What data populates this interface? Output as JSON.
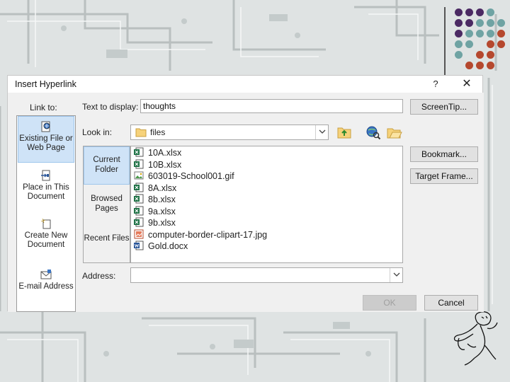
{
  "dialog": {
    "title": "Insert Hyperlink",
    "help_label": "?",
    "close_label": "✕"
  },
  "link_to": {
    "label": "Link to:",
    "items": [
      {
        "label": "Existing File or Web Page",
        "icon": "existing-file-icon",
        "selected": true
      },
      {
        "label": "Place in This Document",
        "icon": "place-in-document-icon",
        "selected": false
      },
      {
        "label": "Create New Document",
        "icon": "new-document-icon",
        "selected": false
      },
      {
        "label": "E-mail Address",
        "icon": "email-icon",
        "selected": false
      }
    ]
  },
  "text_to_display": {
    "label": "Text to display:",
    "value": "thoughts"
  },
  "screen_tip_button": "ScreenTip...",
  "look_in": {
    "label": "Look in:",
    "value": "files",
    "folder_icon": "folder-icon"
  },
  "toolbar_icons": [
    "up-folder-icon",
    "browse-web-icon",
    "browse-file-icon"
  ],
  "places": [
    {
      "label": "Current Folder",
      "selected": true
    },
    {
      "label": "Browsed Pages",
      "selected": false
    },
    {
      "label": "Recent Files",
      "selected": false
    }
  ],
  "files": [
    {
      "name": "10A.xlsx",
      "type": "excel"
    },
    {
      "name": "10B.xlsx",
      "type": "excel"
    },
    {
      "name": "603019-School001.gif",
      "type": "image"
    },
    {
      "name": "8A.xlsx",
      "type": "excel"
    },
    {
      "name": "8b.xlsx",
      "type": "excel"
    },
    {
      "name": "9a.xlsx",
      "type": "excel"
    },
    {
      "name": "9b.xlsx",
      "type": "excel"
    },
    {
      "name": "computer-border-clipart-17.jpg",
      "type": "jpg"
    },
    {
      "name": "Gold.docx",
      "type": "word"
    }
  ],
  "bookmark_button": "Bookmark...",
  "target_frame_button": "Target Frame...",
  "address": {
    "label": "Address:",
    "value": ""
  },
  "ok_button": "OK",
  "cancel_button": "Cancel",
  "colors": {
    "selection_bg": "#cfe3f7",
    "excel_green": "#1e7145",
    "word_blue": "#2b579a",
    "dot_purple": "#4b2a63",
    "dot_teal": "#6fa3a3",
    "dot_red": "#b5482e"
  }
}
